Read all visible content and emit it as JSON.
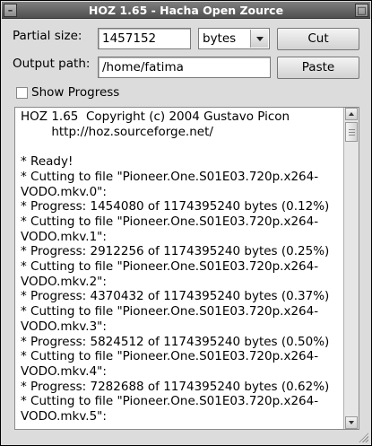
{
  "window": {
    "title": "HOZ 1.65 - Hacha Open Zource"
  },
  "form": {
    "partial_size_label": "Partial size:",
    "partial_size_value": "1457152",
    "unit_selected": "bytes",
    "cut_label": "Cut",
    "output_path_label": "Output path:",
    "output_path_value": "/home/fatima",
    "paste_label": "Paste",
    "show_progress_label": "Show Progress",
    "show_progress_checked": false
  },
  "log": {
    "lines": [
      "HOZ 1.65  Copyright (c) 2004 Gustavo Picon",
      "        http://hoz.sourceforge.net/",
      "",
      "* Ready!",
      "* Cutting to file \"Pioneer.One.S01E03.720p.x264-",
      "VODO.mkv.0\":",
      "* Progress: 1454080 of 1174395240 bytes (0.12%)",
      "* Cutting to file \"Pioneer.One.S01E03.720p.x264-",
      "VODO.mkv.1\":",
      "* Progress: 2912256 of 1174395240 bytes (0.25%)",
      "* Cutting to file \"Pioneer.One.S01E03.720p.x264-",
      "VODO.mkv.2\":",
      "* Progress: 4370432 of 1174395240 bytes (0.37%)",
      "* Cutting to file \"Pioneer.One.S01E03.720p.x264-",
      "VODO.mkv.3\":",
      "* Progress: 5824512 of 1174395240 bytes (0.50%)",
      "* Cutting to file \"Pioneer.One.S01E03.720p.x264-",
      "VODO.mkv.4\":",
      "* Progress: 7282688 of 1174395240 bytes (0.62%)",
      "* Cutting to file \"Pioneer.One.S01E03.720p.x264-",
      "VODO.mkv.5\":"
    ],
    "scroll_fraction": 0.0
  },
  "icons": {
    "window_menu": "window-menu-icon",
    "maximize": "maximize-icon",
    "scroll_up": "arrow-up-icon",
    "scroll_down": "arrow-down-icon",
    "dropdown": "chevron-down-icon"
  }
}
